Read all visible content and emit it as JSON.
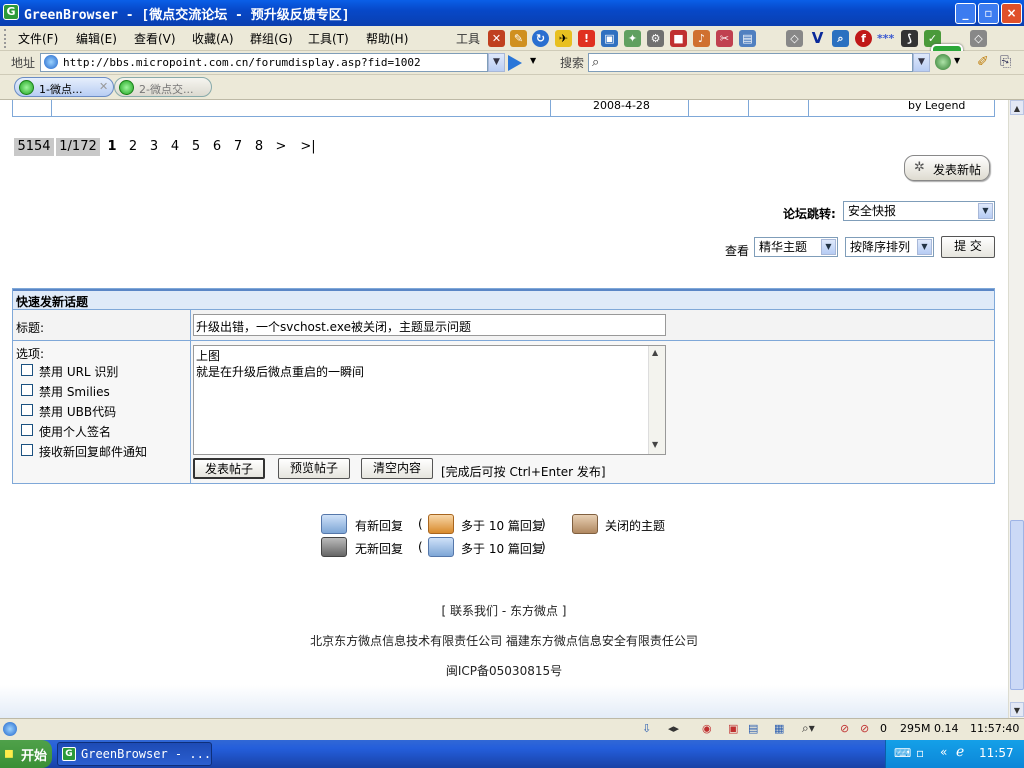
{
  "window": {
    "title": "GreenBrowser - [微点交流论坛 - 预升级反馈专区]",
    "app_icon": "G",
    "minimize": "_",
    "maximize": "▫",
    "close": "×"
  },
  "menu": {
    "items": [
      "文件(F)",
      "编辑(E)",
      "查看(V)",
      "收藏(A)",
      "群组(G)",
      "工具(T)",
      "帮助(H)"
    ],
    "tools_label": "工具"
  },
  "address": {
    "label": "地址",
    "url": "http://bbs.micropoint.com.cn/forumdisplay.asp?fid=1002",
    "search_label": "搜索"
  },
  "tabs": [
    {
      "label": "1-微点...",
      "active": true
    },
    {
      "label": "2-微点交..."
    }
  ],
  "top_row": {
    "date": "2008-4-28",
    "by": "by Legend"
  },
  "pager": {
    "total": "5154",
    "pages": "1/172",
    "current": "1",
    "numbers": [
      "2",
      "3",
      "4",
      "5",
      "6",
      "7",
      "8"
    ],
    "next": ">",
    "last": ">|"
  },
  "new_post_button": "发表新帖",
  "forum_jump": {
    "label": "论坛跳转:",
    "selected": "安全快报"
  },
  "view": {
    "label": "查看",
    "filter_selected": "精华主题",
    "order_selected": "按降序排列",
    "submit": "提  交"
  },
  "quick_post": {
    "header": "快速发新话题",
    "title_label": "标题:",
    "title_value": "升级出错，一个svchost.exe被关闭，主题显示问题",
    "options_label": "选项:",
    "options": [
      "禁用 URL 识别",
      "禁用 Smilies",
      "禁用 UBB代码",
      "使用个人签名",
      "接收新回复邮件通知"
    ],
    "content_line1": "上图",
    "content_line2": "就是在升级后微点重启的一瞬间",
    "submit": "发表帖子",
    "preview": "预览帖子",
    "clear": "清空内容",
    "hint": "[完成后可按 Ctrl+Enter 发布]"
  },
  "legend": {
    "new_reply": "有新回复",
    "hot_new": "多于 10 篇回复",
    "paren_open": "(",
    "paren_close": ")",
    "closed": "关闭的主题",
    "no_new_reply": "无新回复",
    "hot_no_new": "多于 10 篇回复"
  },
  "footer": {
    "contact": "[ 联系我们 - 东方微点 ]",
    "companies": "北京东方微点信息技术有限责任公司 福建东方微点信息安全有限责任公司",
    "icp": "闽ICP备05030815号"
  },
  "status": {
    "count": "0",
    "memory": "295M",
    "cpu": "0.14",
    "time": "11:57:40"
  },
  "taskbar": {
    "start": "开始",
    "task": "GreenBrowser - ...",
    "clock": "11:57"
  },
  "colors": {
    "table_header_bg": "#dfeaf8",
    "border": "#7fa8d8",
    "pager_grey": "#c8c8c8"
  }
}
